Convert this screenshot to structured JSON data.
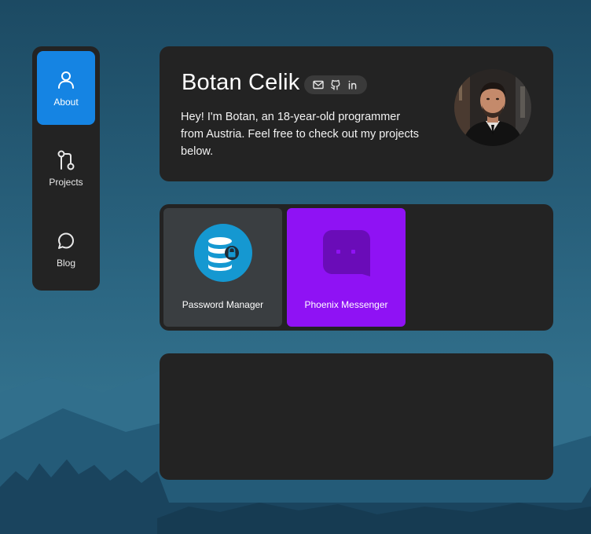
{
  "nav": {
    "items": [
      {
        "label": "About",
        "icon": "user-icon",
        "active": true
      },
      {
        "label": "Projects",
        "icon": "git-pull-request-icon",
        "active": false
      },
      {
        "label": "Blog",
        "icon": "message-circle-icon",
        "active": false
      }
    ]
  },
  "profile": {
    "name": "Botan Celik",
    "bio": "Hey! I'm Botan, an 18-year-old programmer from Austria. Feel free to check out my projects below.",
    "socials": [
      "mail-icon",
      "github-icon",
      "linkedin-icon"
    ]
  },
  "projects": [
    {
      "label": "Password Manager",
      "icon": "database-lock-icon",
      "color": "#3a3e41"
    },
    {
      "label": "Phoenix Messenger",
      "icon": "chat-bubble-icon",
      "color": "#8f12f4"
    }
  ],
  "colors": {
    "accent": "#1584e3",
    "card": "#232323",
    "phoenix": "#8f12f4"
  }
}
